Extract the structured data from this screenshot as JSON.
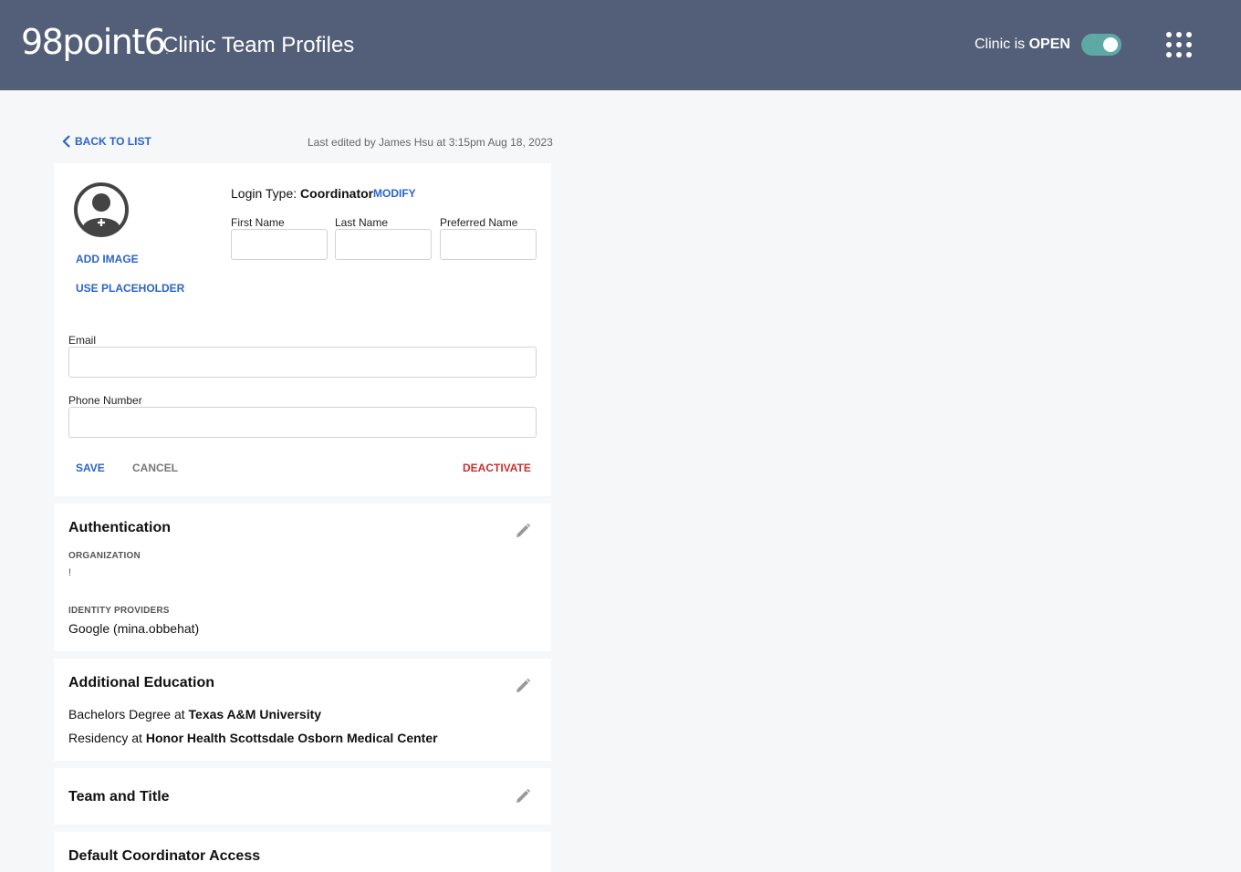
{
  "header": {
    "logo": "98point6",
    "logo_mark": ".",
    "title": "Clinic Team Profiles",
    "clinic_status_prefix": "Clinic is",
    "clinic_status_value": "OPEN",
    "toggle_on": true,
    "accent": "#5ea9a6",
    "bar_color": "#535f78"
  },
  "nav": {
    "back_label": "BACK TO LIST",
    "last_edited": "Last edited by James Hsu at 3:15pm  Aug 18, 2023"
  },
  "profile": {
    "add_image": "ADD IMAGE",
    "use_placeholder": "USE PLACEHOLDER",
    "login_type_label": "Login Type:",
    "login_type_value": "Coordinator",
    "modify": "MODIFY",
    "first_name_label": "First Name",
    "first_name_value": "",
    "last_name_label": "Last Name",
    "last_name_value": "",
    "preferred_name_label": "Preferred Name",
    "preferred_name_value": "",
    "email_label": "Email",
    "email_value": "",
    "phone_label": "Phone Number",
    "phone_value": "",
    "save": "SAVE",
    "cancel": "CANCEL",
    "deactivate": "DEACTIVATE"
  },
  "authentication": {
    "title": "Authentication",
    "org_label": "ORGANIZATION",
    "org_value": "!",
    "idp_label": "IDENTITY PROVIDERS",
    "idp_value": "Google (mina.obbehat)"
  },
  "education": {
    "title": "Additional Education",
    "items": [
      {
        "prefix": "Bachelors Degree at",
        "institution": "Texas A&M University"
      },
      {
        "prefix": "Residency at",
        "institution": "Honor Health Scottsdale Osborn Medical Center"
      }
    ]
  },
  "team": {
    "title": "Team and Title"
  },
  "coordinator": {
    "title": "Default Coordinator Access"
  }
}
